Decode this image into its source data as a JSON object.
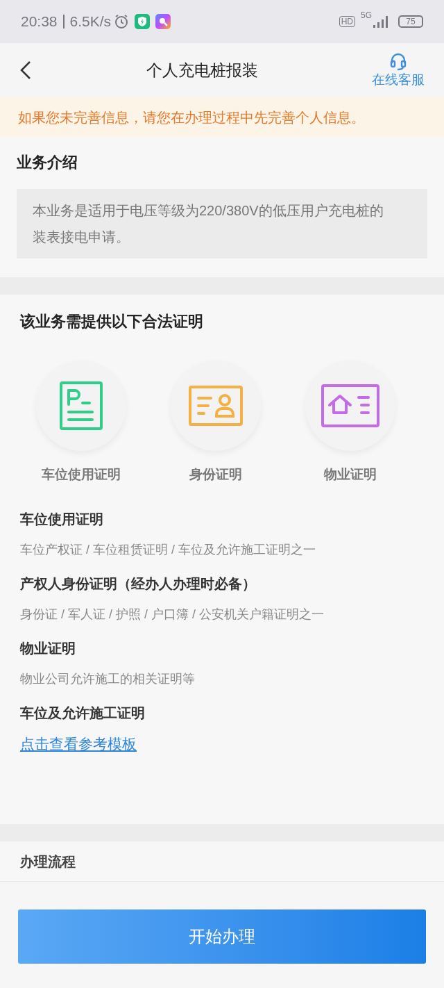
{
  "status_bar": {
    "time": "20:38",
    "speed": "6.5K/s",
    "hd": "HD",
    "network": "5G",
    "battery": "75"
  },
  "header": {
    "title": "个人充电桩报装",
    "service": "在线客服"
  },
  "notice": "如果您未完善信息，请您在办理过程中先完善个人信息。",
  "intro": {
    "title": "业务介绍",
    "text": "本业务是适用于电压等级为220/380V的低压用户充电桩的装表接电申请。"
  },
  "documents": {
    "title": "该业务需提供以下合法证明",
    "items": [
      {
        "kind": "parking",
        "label": "车位使用证明",
        "color": "#2fcf8a"
      },
      {
        "kind": "identity",
        "label": "身份证明",
        "color": "#f5b041"
      },
      {
        "kind": "property",
        "label": "物业证明",
        "color": "#c36be8"
      }
    ],
    "details": [
      {
        "title": "车位使用证明",
        "text": "车位产权证 / 车位租赁证明 / 车位及允许施工证明之一"
      },
      {
        "title": "产权人身份证明（经办人办理时必备）",
        "text": "身份证 / 军人证 / 护照 / 户口簿 / 公安机关户籍证明之一"
      },
      {
        "title": "物业证明",
        "text": "物业公司允许施工的相关证明等"
      },
      {
        "title": "车位及允许施工证明",
        "link": "点击查看参考模板"
      }
    ]
  },
  "process": {
    "title": "办理流程"
  },
  "start_button": "开始办理"
}
